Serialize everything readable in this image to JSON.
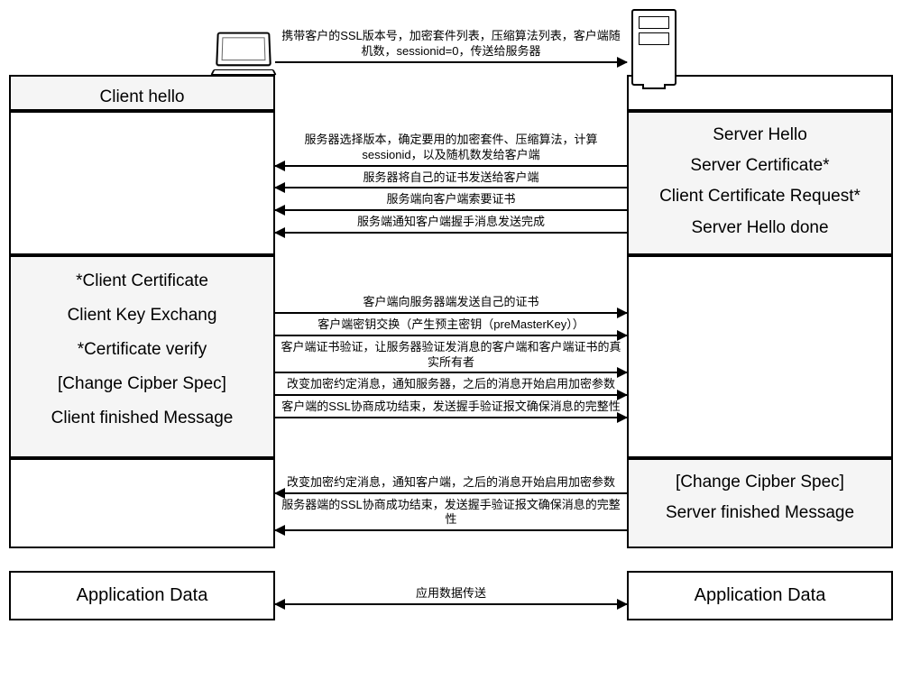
{
  "client": {
    "hello": "Client hello",
    "phase2_lines": [
      "*Client Certificate",
      "Client Key Exchang",
      "*Certificate verify",
      "[Change Cipber Spec]",
      "Client finished Message"
    ]
  },
  "server": {
    "phase1_lines": [
      "Server Hello",
      "Server Certificate*",
      "Client Certificate Request*",
      "Server Hello done"
    ],
    "phase2_lines": [
      "[Change Cipber Spec]",
      "Server finished Message"
    ]
  },
  "app": {
    "client": "Application Data",
    "server": "Application Data",
    "arrow": "应用数据传送"
  },
  "arrows": {
    "a1": "携带客户的SSL版本号，加密套件列表，压缩算法列表，客户端随机数，sessionid=0，传送给服务器",
    "a2": "服务器选择版本，确定要用的加密套件、压缩算法，计算sessionid，以及随机数发给客户端",
    "a3": "服务器将自己的证书发送给客户端",
    "a4": "服务端向客户端索要证书",
    "a5": "服务端通知客户端握手消息发送完成",
    "a6": "客户端向服务器端发送自己的证书",
    "a7": "客户端密钥交换（产生预主密钥（preMasterKey））",
    "a8": "客户端证书验证，让服务器验证发消息的客户端和客户端证书的真实所有者",
    "a9": "改变加密约定消息，通知服务器，之后的消息开始启用加密参数",
    "a10": "客户端的SSL协商成功结束，发送握手验证报文确保消息的完整性",
    "a11": "改变加密约定消息，通知客户端，之后的消息开始启用加密参数",
    "a12": "服务器端的SSL协商成功结束，发送握手验证报文确保消息的完整性"
  },
  "icons": {
    "laptop": "laptop-icon",
    "server": "server-icon"
  }
}
